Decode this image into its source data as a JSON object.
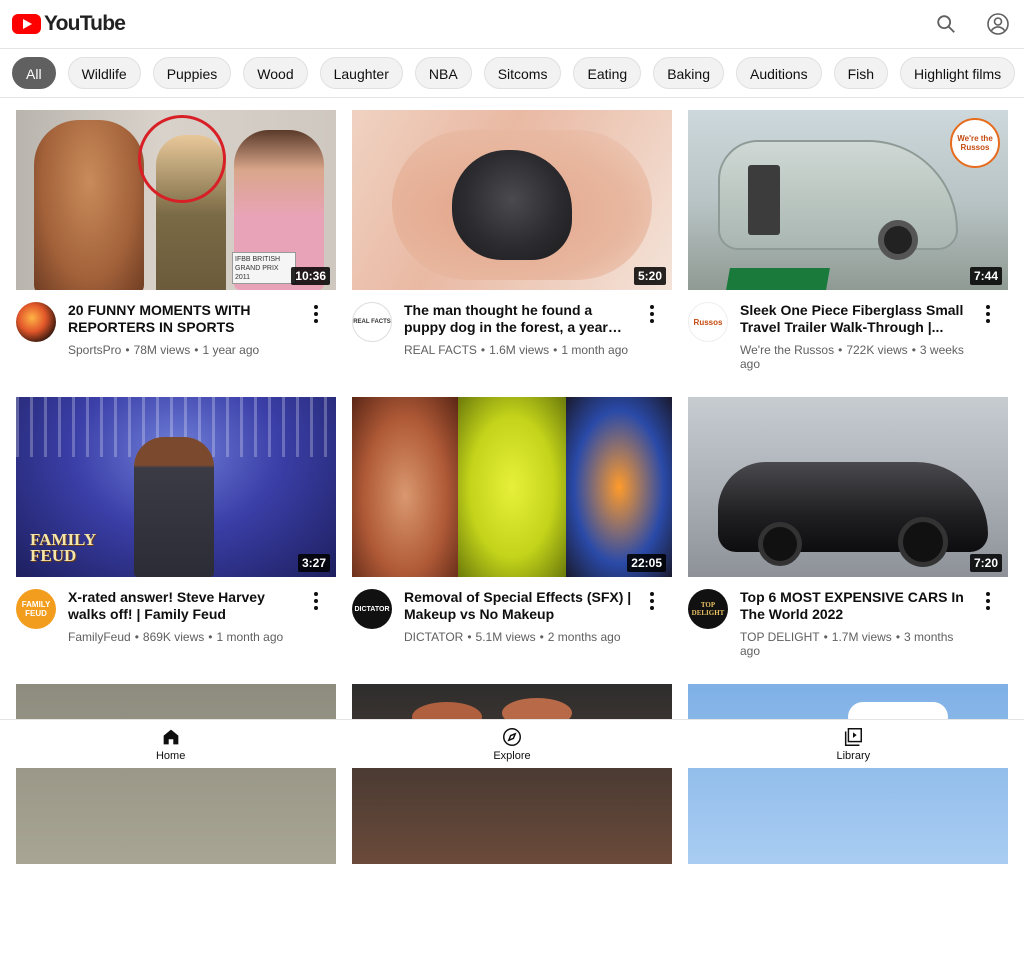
{
  "header": {
    "logo_text": "YouTube",
    "search_icon": "search-icon",
    "account_icon": "account-icon"
  },
  "chips": [
    "All",
    "Wildlife",
    "Puppies",
    "Wood",
    "Laughter",
    "NBA",
    "Sitcoms",
    "Eating",
    "Baking",
    "Auditions",
    "Fish",
    "Highlight films"
  ],
  "videos": [
    {
      "title": "20 FUNNY MOMENTS WITH REPORTERS IN SPORTS",
      "channel": "SportsPro",
      "views": "78M views",
      "age": "1 year ago",
      "duration": "10:36",
      "thumb_text": "IFBB BRITISH GRAND PRIX 2011"
    },
    {
      "title": "The man thought he found a puppy dog in the forest, a year later he w...",
      "channel": "REAL FACTS",
      "views": "1.6M views",
      "age": "1 month ago",
      "duration": "5:20",
      "avatar_text": "REAL FACTS"
    },
    {
      "title": "Sleek One Piece Fiberglass Small Travel Trailer Walk-Through |...",
      "channel": "We're the Russos",
      "views": "722K views",
      "age": "3 weeks ago",
      "duration": "7:44",
      "thumb_text": "We're the Russos",
      "avatar_text": "Russos"
    },
    {
      "title": "X-rated answer! Steve Harvey walks off! | Family Feud",
      "channel": "FamilyFeud",
      "views": "869K views",
      "age": "1 month ago",
      "duration": "3:27",
      "thumb_text": "FAMILY FEUD",
      "avatar_text": "FAMILY FEUD"
    },
    {
      "title": "Removal of Special Effects (SFX) | Makeup vs No Makeup",
      "channel": "DICTATOR",
      "views": "5.1M views",
      "age": "2 months ago",
      "duration": "22:05",
      "avatar_text": "DICTATOR"
    },
    {
      "title": "Top 6 MOST EXPENSIVE CARS In The World 2022",
      "channel": "TOP DELIGHT",
      "views": "1.7M views",
      "age": "3 months ago",
      "duration": "7:20",
      "avatar_text": "TOP DELIGHT"
    }
  ],
  "bottom_nav": [
    {
      "label": "Home",
      "icon": "home-icon"
    },
    {
      "label": "Explore",
      "icon": "compass-icon"
    },
    {
      "label": "Library",
      "icon": "library-icon"
    }
  ],
  "colors": {
    "brand_red": "#ff0000",
    "active_chip": "#606060",
    "meta_text": "#606060"
  }
}
